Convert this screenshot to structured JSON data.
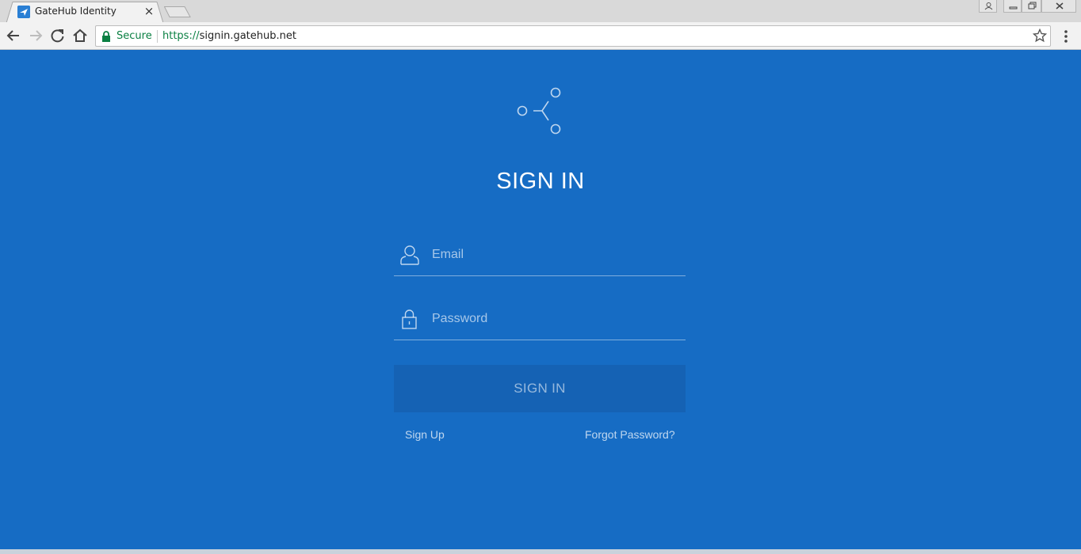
{
  "browser": {
    "tab_title": "GateHub Identity",
    "tab_close": "×",
    "secure_label": "Secure",
    "url_scheme": "https://",
    "url_host": "signin.gatehub.net"
  },
  "signin": {
    "title": "SIGN IN",
    "email_placeholder": "Email",
    "password_placeholder": "Password",
    "submit_label": "SIGN IN",
    "signup_link": "Sign Up",
    "forgot_link": "Forgot Password?"
  },
  "colors": {
    "page_bg": "#166cc4",
    "button_bg": "#1562b4",
    "secure_green": "#0b8043"
  },
  "icons": {
    "favicon": "gatehub-favicon-icon",
    "logo": "gatehub-logo-icon",
    "email": "user-icon",
    "password": "lock-icon"
  }
}
